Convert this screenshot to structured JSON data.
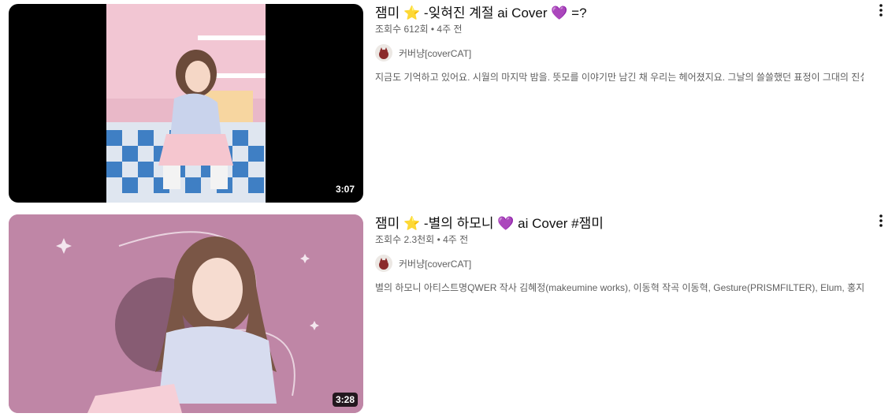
{
  "videos": [
    {
      "title_prefix": "잼미",
      "title_star": "⭐",
      "title_middle": " -잊혀진 계절 ai Cover",
      "title_heart": "💜",
      "title_suffix": " =?",
      "views": "조회수 612회",
      "separator": "•",
      "age": "4주 전",
      "channel": "커버냥[coverCAT]",
      "description": "지금도 기억하고 있어요. 시월의 마지막 밤을. 뜻모를 이야기만 남긴 채 우리는 헤어졌지요. 그날의 쓸쓸했던 표정이 그대의 진실 ...",
      "duration": "3:07",
      "thumbnail_icon": "video-thumbnail-image"
    },
    {
      "title_prefix": "잼미",
      "title_star": "⭐",
      "title_middle": " -별의 하모니 ",
      "title_heart": "💜",
      "title_suffix": " ai Cover #잼미",
      "views": "조회수 2.3천회",
      "separator": "•",
      "age": "4주 전",
      "channel": "커버냥[coverCAT]",
      "description": "별의 하모니 아티스트명QWER 작사 김혜정(makeumine works), 이동혁 작곡 이동혁, Gesture(PRISMFILTER), Elum, 홍지혜, 시연 ...",
      "duration": "3:28",
      "thumbnail_icon": "video-thumbnail-image"
    }
  ],
  "icons": {
    "menu": "more-vert-icon"
  },
  "colors": {
    "text": "#0f0f0f",
    "secondary": "#606060",
    "thumb1_bg": "#000000",
    "thumb2_bg": "#bf86a6"
  }
}
